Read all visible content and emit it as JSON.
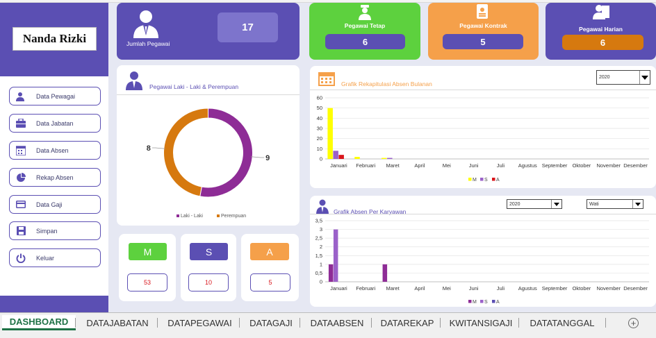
{
  "sidebar": {
    "user_name": "Nanda Rizki",
    "menu": [
      {
        "label": "Data Pewagai",
        "icon": "user-icon"
      },
      {
        "label": "Data Jabatan",
        "icon": "briefcase-icon"
      },
      {
        "label": "Data Absen",
        "icon": "calendar-icon"
      },
      {
        "label": "Rekap Absen",
        "icon": "pie-chart-icon"
      },
      {
        "label": "Data Gaji",
        "icon": "card-icon"
      },
      {
        "label": "Simpan",
        "icon": "save-icon"
      },
      {
        "label": "Keluar",
        "icon": "power-icon"
      }
    ]
  },
  "kpi": {
    "total": {
      "label": "Jumlah Pegawai",
      "value": "17"
    },
    "tetap": {
      "label": "Pegawai Tetap",
      "value": "6"
    },
    "kontrak": {
      "label": "Pegawai Kontrak",
      "value": "5"
    },
    "harian": {
      "label": "Pegawai Harian",
      "value": "6"
    }
  },
  "gender_panel": {
    "title": "Pegawai Laki - Laki & Perempuan"
  },
  "attendance": {
    "M": {
      "label": "M",
      "value": "53"
    },
    "S": {
      "label": "S",
      "value": "10"
    },
    "A": {
      "label": "A",
      "value": "5"
    }
  },
  "monthly_panel": {
    "title": "Grafik Rekapitulasi Absen Bulanan",
    "year_select": "2020"
  },
  "employee_panel": {
    "title": "Grafik Absen Per Karyawan",
    "year_select": "2020",
    "employee_select": "Wati"
  },
  "colors": {
    "purple": "#5b4fb3",
    "green": "#5dd13e",
    "orange": "#f5a04a",
    "dark_orange": "#d6790f",
    "magenta": "#8e2c96",
    "yellow": "#ffff00",
    "red": "#d9161c",
    "violet": "#9b61c9"
  },
  "chart_data": [
    {
      "type": "pie",
      "labels": [
        "Laki - Laki",
        "Perempuan"
      ],
      "values": [
        9,
        8
      ],
      "legend": "bottom"
    },
    {
      "type": "bar",
      "categories": [
        "Januari",
        "Februari",
        "Maret",
        "April",
        "Mei",
        "Juni",
        "Juli",
        "Agustus",
        "September",
        "Oktober",
        "November",
        "Desember"
      ],
      "series": [
        {
          "name": "M",
          "values": [
            50,
            2,
            1,
            0,
            0,
            0,
            0,
            0,
            0,
            0,
            0,
            0
          ]
        },
        {
          "name": "S",
          "values": [
            8,
            0,
            1,
            0,
            0,
            0,
            0,
            0,
            0,
            0,
            0,
            0
          ]
        },
        {
          "name": "A",
          "values": [
            4,
            0,
            0,
            0,
            0,
            0,
            0,
            0,
            0,
            0,
            0,
            0
          ]
        }
      ],
      "yticks": [
        "0",
        "10",
        "20",
        "30",
        "40",
        "50",
        "60"
      ],
      "ylim": [
        0,
        60
      ],
      "legend": "bottom",
      "grid": true
    },
    {
      "type": "bar",
      "categories": [
        "Januari",
        "Februari",
        "Maret",
        "April",
        "Mei",
        "Juni",
        "Juli",
        "Agustus",
        "September",
        "Oktober",
        "November",
        "Desember"
      ],
      "series": [
        {
          "name": "M",
          "values": [
            1,
            0,
            1,
            0,
            0,
            0,
            0,
            0,
            0,
            0,
            0,
            0
          ]
        },
        {
          "name": "S",
          "values": [
            3,
            0,
            0,
            0,
            0,
            0,
            0,
            0,
            0,
            0,
            0,
            0
          ]
        },
        {
          "name": "A",
          "values": [
            0,
            0,
            0,
            0,
            0,
            0,
            0,
            0,
            0,
            0,
            0,
            0
          ]
        }
      ],
      "yticks": [
        "0",
        "0,5",
        "1",
        "1,5",
        "2",
        "2,5",
        "3",
        "3,5"
      ],
      "ylim": [
        0,
        3.5
      ],
      "legend": "bottom",
      "grid": true
    }
  ],
  "tabs": [
    {
      "label": "DASHBOARD",
      "active": true
    },
    {
      "label": "DATAJABATAN"
    },
    {
      "label": "DATAPEGAWAI"
    },
    {
      "label": "DATAGAJI"
    },
    {
      "label": "DATAABSEN"
    },
    {
      "label": "DATAREKAP"
    },
    {
      "label": "KWITANSIGAJI"
    },
    {
      "label": "DATATANGGAL"
    }
  ]
}
